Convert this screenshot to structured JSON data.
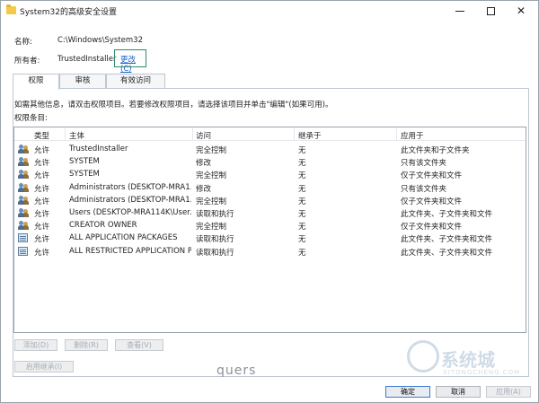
{
  "window": {
    "title": "System32的高级安全设置"
  },
  "info": {
    "name_label": "名称:",
    "name_value": "C:\\Windows\\System32",
    "owner_label": "所有者:",
    "owner_value": "TrustedInstaller",
    "change_link": "更改(C)"
  },
  "tabs": [
    "权限",
    "审核",
    "有效访问"
  ],
  "active_tab": 0,
  "instructions": "如需其他信息，请双击权限项目。若要修改权限项目，请选择该项目并单击\"编辑\"(如果可用)。",
  "list_label": "权限条目:",
  "columns": [
    "类型",
    "主体",
    "访问",
    "继承于",
    "应用于"
  ],
  "entries": [
    {
      "icon": "user-group-icon",
      "type": "允许",
      "principal": "TrustedInstaller",
      "access": "完全控制",
      "inherited": "无",
      "applies": "此文件夹和子文件夹"
    },
    {
      "icon": "user-group-icon",
      "type": "允许",
      "principal": "SYSTEM",
      "access": "修改",
      "inherited": "无",
      "applies": "只有该文件夹"
    },
    {
      "icon": "user-group-icon",
      "type": "允许",
      "principal": "SYSTEM",
      "access": "完全控制",
      "inherited": "无",
      "applies": "仅子文件夹和文件"
    },
    {
      "icon": "user-group-icon",
      "type": "允许",
      "principal": "Administrators (DESKTOP-MRA1...",
      "access": "修改",
      "inherited": "无",
      "applies": "只有该文件夹"
    },
    {
      "icon": "user-group-icon",
      "type": "允许",
      "principal": "Administrators (DESKTOP-MRA1...",
      "access": "完全控制",
      "inherited": "无",
      "applies": "仅子文件夹和文件"
    },
    {
      "icon": "user-group-icon",
      "type": "允许",
      "principal": "Users (DESKTOP-MRA114K\\User...",
      "access": "读取和执行",
      "inherited": "无",
      "applies": "此文件夹、子文件夹和文件"
    },
    {
      "icon": "user-group-icon",
      "type": "允许",
      "principal": "CREATOR OWNER",
      "access": "完全控制",
      "inherited": "无",
      "applies": "仅子文件夹和文件"
    },
    {
      "icon": "package-icon",
      "type": "允许",
      "principal": "ALL APPLICATION PACKAGES",
      "access": "读取和执行",
      "inherited": "无",
      "applies": "此文件夹、子文件夹和文件"
    },
    {
      "icon": "package-icon",
      "type": "允许",
      "principal": "ALL RESTRICTED APPLICATION P...",
      "access": "读取和执行",
      "inherited": "无",
      "applies": "此文件夹、子文件夹和文件"
    }
  ],
  "buttons": {
    "add": "添加(D)",
    "remove": "删除(R)",
    "view": "查看(V)",
    "enable_inheritance": "启用继承(I)",
    "ok": "确定",
    "cancel": "取消",
    "apply": "应用(A)"
  },
  "watermark": "quers",
  "logo": {
    "text": "系统城",
    "sub": "XITONGCHENG.COM"
  }
}
